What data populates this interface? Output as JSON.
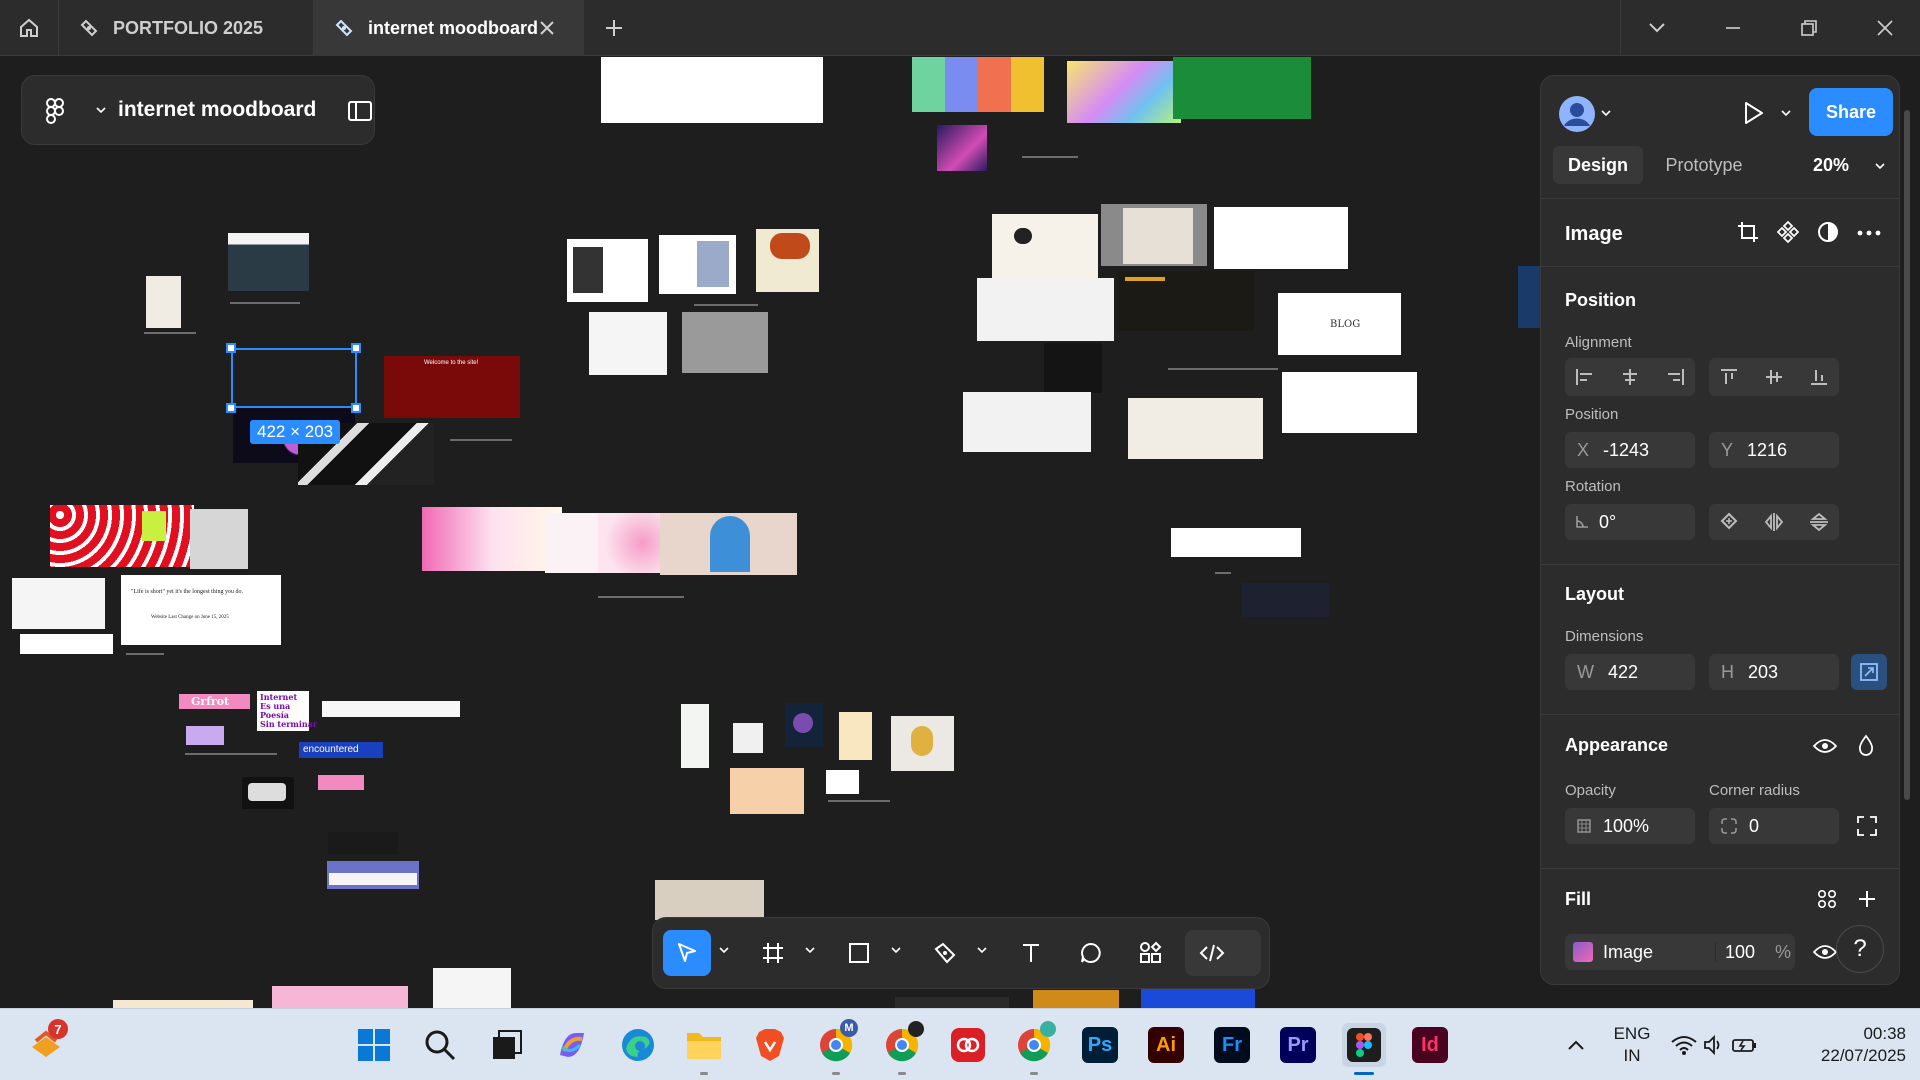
{
  "window": {
    "tabs": [
      {
        "label": "PORTFOLIO 2025",
        "active": false
      },
      {
        "label": "internet moodboard",
        "active": true
      }
    ]
  },
  "file": {
    "name": "internet moodboard"
  },
  "selection": {
    "size_badge": "422 × 203"
  },
  "toolbar": {
    "tools": [
      "move-tool",
      "frame-tool",
      "shape-tool",
      "pen-tool",
      "text-tool",
      "comment-tool",
      "actions-tool",
      "dev-mode-toggle"
    ]
  },
  "panel": {
    "share_label": "Share",
    "tabs": [
      "Design",
      "Prototype"
    ],
    "zoom": "20%",
    "layer_type": "Image",
    "position": {
      "heading": "Position",
      "alignment_label": "Alignment",
      "position_label": "Position",
      "x_label": "X",
      "x_value": "-1243",
      "y_label": "Y",
      "y_value": "1216",
      "rotation_label": "Rotation",
      "rotation_value": "0°"
    },
    "layout": {
      "heading": "Layout",
      "dimensions_label": "Dimensions",
      "w_label": "W",
      "w_value": "422",
      "h_label": "H",
      "h_value": "203"
    },
    "appearance": {
      "heading": "Appearance",
      "opacity_label": "Opacity",
      "opacity_value": "100%",
      "corner_label": "Corner radius",
      "corner_value": "0"
    },
    "fill": {
      "heading": "Fill",
      "type": "Image",
      "opacity": "100",
      "unit": "%"
    },
    "help": "?"
  },
  "canvas_text": {
    "tile_internet": "Internet\nEs una\nPoesía\nSin terminar",
    "tile_grfrot": "Grfrot",
    "tile_encountered": "encountered",
    "tile_blog": "BLOG",
    "tile_welcome": "Welcome to the site!",
    "tile_quote": "\"Life is short\" yet it's the longest thing you do.",
    "tile_quote_sub": "Website Last Change on June 15, 2025"
  },
  "taskbar": {
    "notification_badge": "7",
    "lang_line1": "ENG",
    "lang_line2": "IN",
    "time": "00:38",
    "date": "22/07/2025",
    "apps": [
      "Ps",
      "Ai",
      "Fr",
      "Pr",
      "Id"
    ]
  },
  "colors": {
    "accent": "#2b8cff",
    "canvas_bg": "#1e1e1e",
    "panel_bg": "#2c2c2c",
    "photoshop": "#31a8ff",
    "illustrator": "#ff9a00",
    "fresco": "#1c8cff",
    "premiere": "#9999ff",
    "indesign": "#ff3366"
  }
}
